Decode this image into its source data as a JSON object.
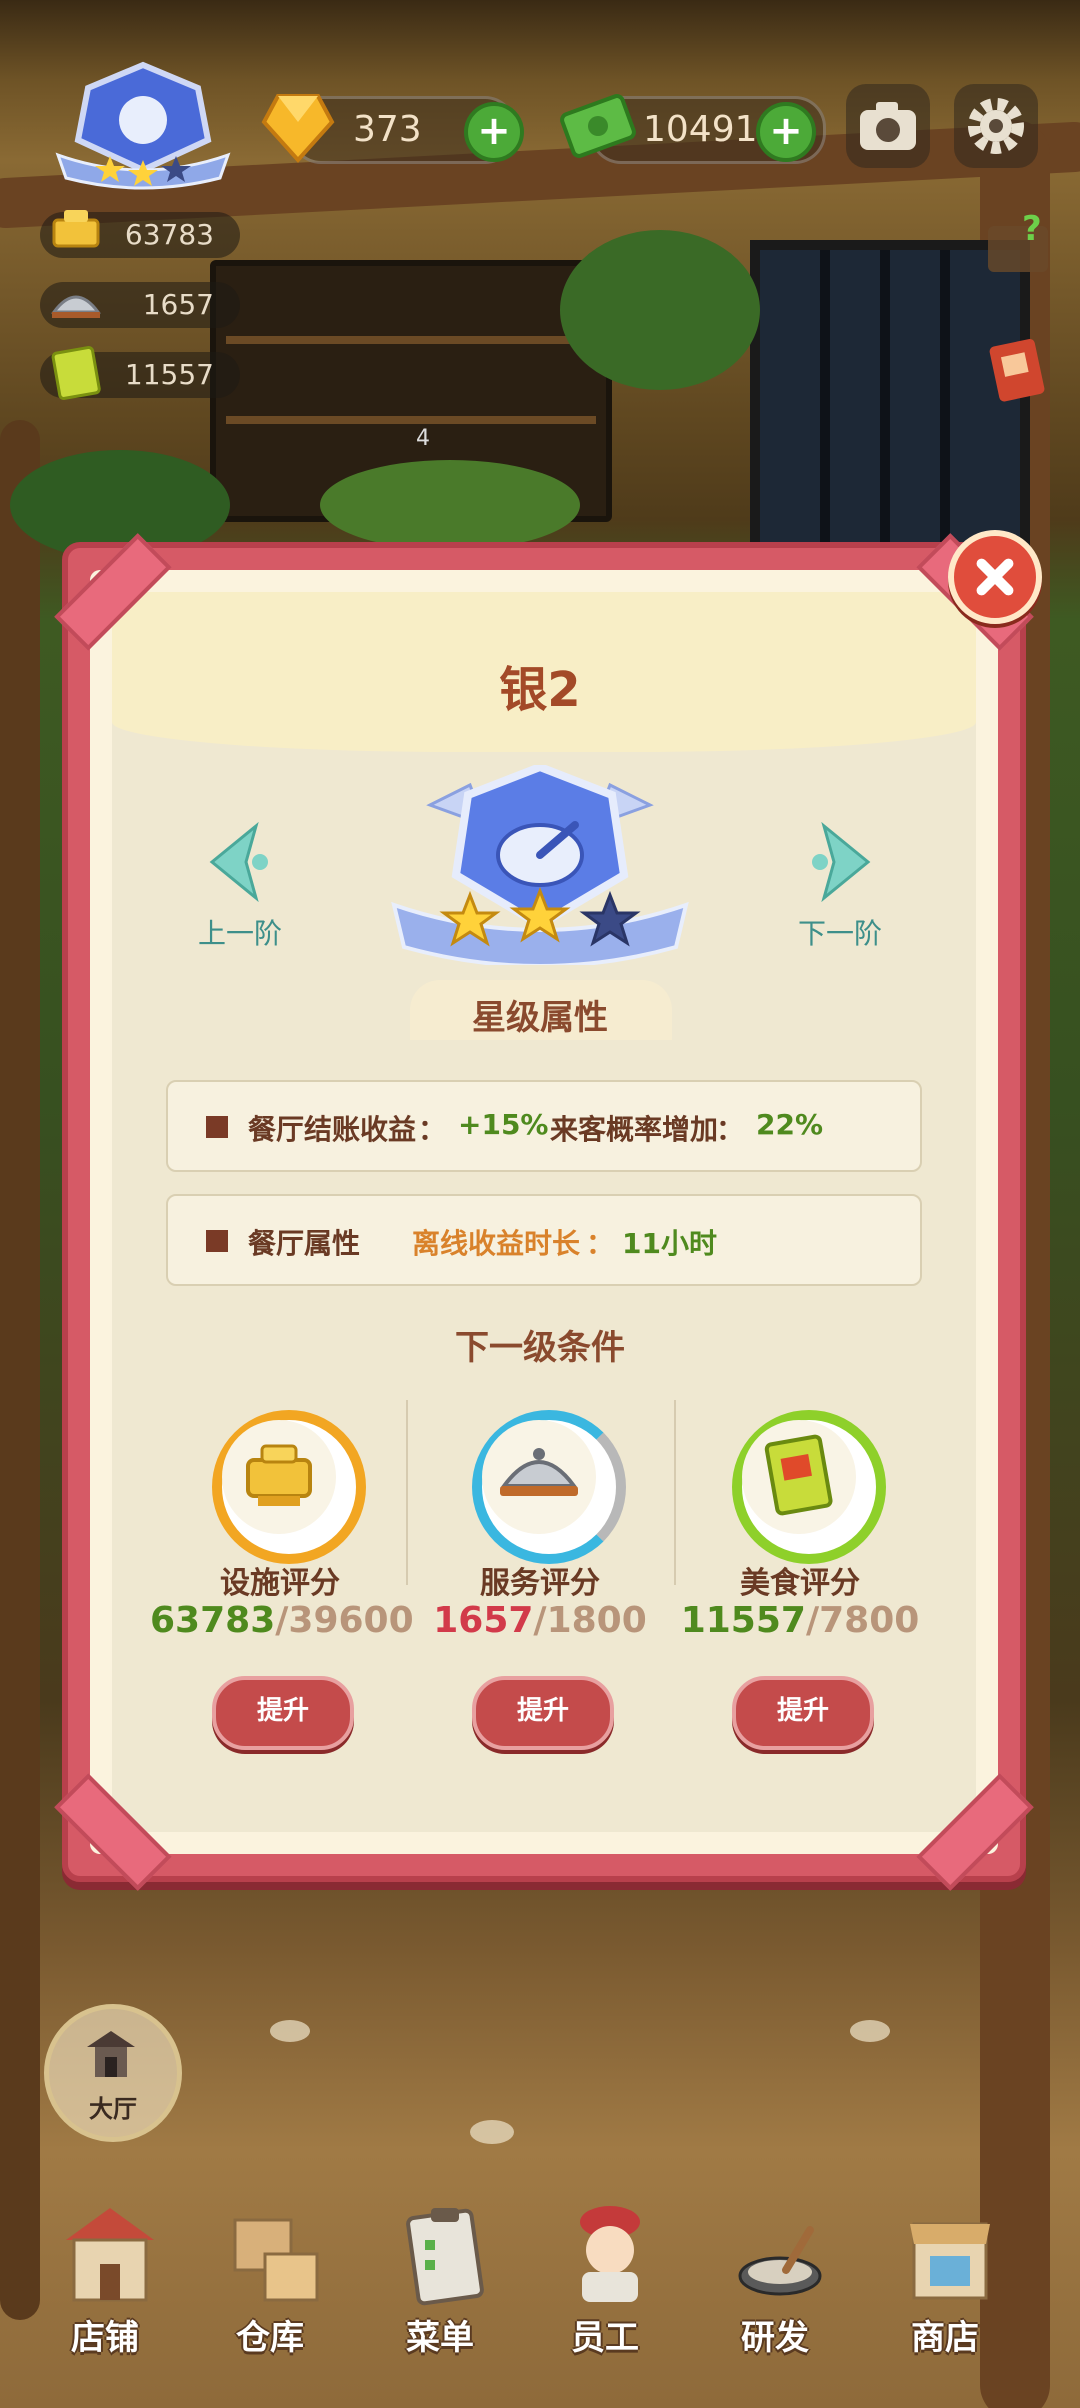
{
  "hud": {
    "gems": "373",
    "cash": "104915",
    "stats": [
      {
        "icon": "facility-icon",
        "value": "63783"
      },
      {
        "icon": "service-icon",
        "value": "1657"
      },
      {
        "icon": "food-icon",
        "value": "11557"
      }
    ],
    "shelf_count": "4"
  },
  "modal": {
    "title": "银2",
    "prev_label": "上一阶",
    "next_label": "下一阶",
    "stars_filled": 2,
    "stars_total": 3,
    "attributes_title": "星级属性",
    "attr1": {
      "label": "餐厅结账收益",
      "sep1": "：",
      "value1": "+15%",
      "label2": "来客概率增加",
      "sep2": "：",
      "value2": "22%"
    },
    "attr2": {
      "label": "餐厅属性",
      "offline_label": "离线收益时长",
      "sep": "：",
      "offline_value": "11小时"
    },
    "next_level_title": "下一级条件",
    "scores": [
      {
        "label": "设施评分",
        "current": "63783",
        "slash": "/",
        "required": "39600",
        "button": "提升",
        "ring_color": "#f2a622",
        "current_color": "#4f8a1e",
        "progress": 1.0
      },
      {
        "label": "服务评分",
        "current": "1657",
        "slash": "/",
        "required": "1800",
        "button": "提升",
        "ring_color": "#3ab7e0",
        "current_color": "#d23a4a",
        "progress": 0.92
      },
      {
        "label": "美食评分",
        "current": "11557",
        "slash": "/",
        "required": "7800",
        "button": "提升",
        "ring_color": "#8ed02a",
        "current_color": "#4f8a1e",
        "progress": 1.0
      }
    ]
  },
  "hall": {
    "label": "大厅"
  },
  "nav": [
    {
      "label": "店铺",
      "icon": "shop-building-icon"
    },
    {
      "label": "仓库",
      "icon": "warehouse-boxes-icon"
    },
    {
      "label": "菜单",
      "icon": "menu-clipboard-icon"
    },
    {
      "label": "员工",
      "icon": "staff-chef-icon"
    },
    {
      "label": "研发",
      "icon": "research-pan-icon"
    },
    {
      "label": "商店",
      "icon": "store-stall-icon"
    }
  ],
  "colors": {
    "accent_red": "#d65a66",
    "title_brown": "#a34a28",
    "teal": "#3d8f8a",
    "green_value": "#4f8a1e",
    "orange_value": "#d9822b"
  }
}
